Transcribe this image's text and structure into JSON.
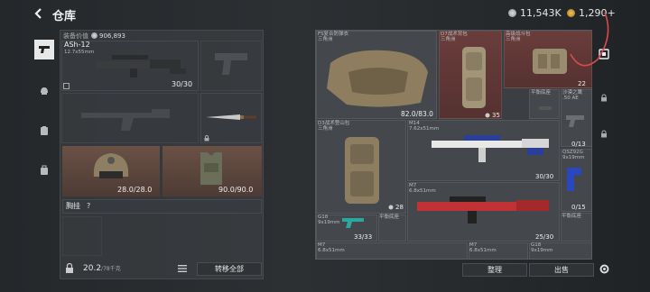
{
  "header": {
    "title": "仓库",
    "currency_silver": "11,543K",
    "currency_gold": "1,290+"
  },
  "loadout": {
    "value_label": "装备价值",
    "value": "906,893",
    "primary": {
      "name": "ASh-12",
      "caliber": "12.7x55mm",
      "ammo": "30/30"
    },
    "helmet_durability": "28.0/28.0",
    "armor_durability": "90.0/90.0",
    "chest_rig_label": "胸挂",
    "chest_rig_hint": "?",
    "weight": "20.2",
    "weight_max": "/78千克",
    "transfer_all": "转移全部"
  },
  "stash": {
    "items": [
      {
        "name": "FS复合防弹衣",
        "grade": "三角洲",
        "durability": "82.0/83.0"
      },
      {
        "name": "D7战术背包",
        "grade": "三角洲",
        "count": "35"
      },
      {
        "name": "高级战斗包",
        "grade": "三角洲",
        "count": "22"
      },
      {
        "name": "D3战术登山包",
        "grade": "三角洲",
        "count": "28"
      },
      {
        "name": "M14",
        "caliber": "7.62x51mm",
        "ammo": "30/30"
      },
      {
        "name": "M7",
        "caliber": "6.8x51mm",
        "ammo": "25/30"
      },
      {
        "name": "G18",
        "caliber": "9x19mm",
        "ammo": "33/33"
      },
      {
        "name": "沙漠之鹰",
        "caliber": ".50 AE",
        "count": "0/13"
      },
      {
        "name": "QSZ92G",
        "caliber": "9x19mm",
        "count": "0/15"
      },
      {
        "name": "M7",
        "caliber": "6.8x51mm"
      },
      {
        "name": "M7",
        "caliber": "6.8x51mm"
      },
      {
        "name": "G18",
        "caliber": "9x19mm"
      }
    ],
    "mount_label": "平衡底座",
    "sort_label": "整理",
    "sell_label": "出售"
  }
}
